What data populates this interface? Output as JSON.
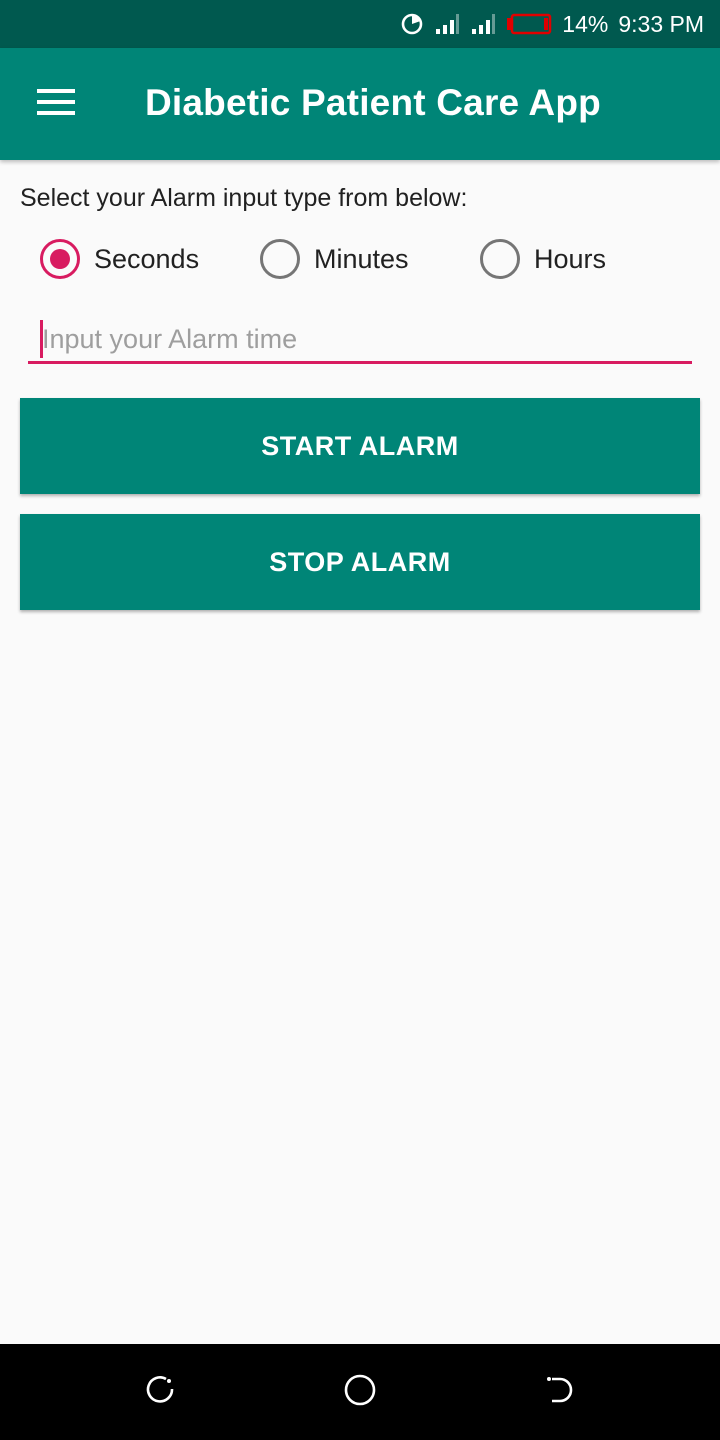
{
  "status_bar": {
    "battery_percent": "14%",
    "time": "9:33 PM",
    "icons": [
      "data-saver-icon",
      "signal-icon-sim1",
      "signal-icon-sim2",
      "battery-low-icon"
    ],
    "battery_color": "#e00000"
  },
  "app_bar": {
    "title": "Diabetic Patient Care App",
    "menu_icon": "hamburger-menu-icon",
    "color": "#008577"
  },
  "form": {
    "prompt": "Select your Alarm input type from below:",
    "radio_options": [
      {
        "label": "Seconds",
        "checked": true
      },
      {
        "label": "Minutes",
        "checked": false
      },
      {
        "label": "Hours",
        "checked": false
      }
    ],
    "alarm_input": {
      "value": "",
      "placeholder": "Input your Alarm time"
    },
    "accent_color": "#d81b60"
  },
  "buttons": {
    "start_label": "START ALARM",
    "stop_label": "STOP ALARM"
  },
  "nav_bar": {
    "icons": [
      "recents-icon",
      "home-icon",
      "back-icon"
    ]
  }
}
